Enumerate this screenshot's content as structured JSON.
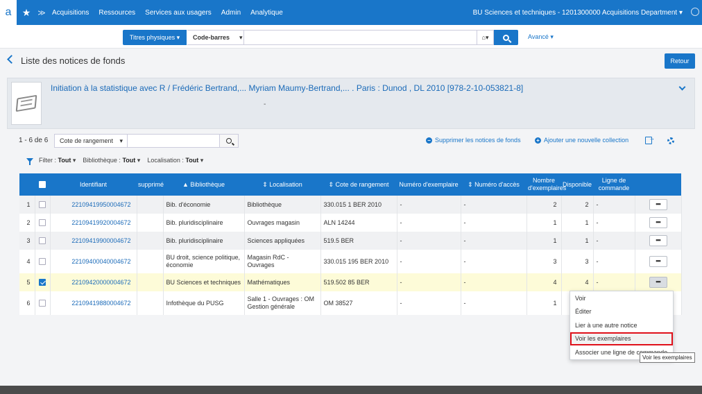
{
  "topnav": {
    "logo_fragment": "a",
    "items": [
      "Acquisitions",
      "Ressources",
      "Services aux usagers",
      "Admin",
      "Analytique"
    ],
    "institution": "BU Sciences et techniques - 1201300000 Acquisitions Department ▾"
  },
  "search": {
    "scope": "Titres physiques ▾",
    "field": "Code-barres",
    "value": "",
    "advanced": "Avancé ▾"
  },
  "page": {
    "title": "Liste des notices de fonds",
    "back_button": "Retour"
  },
  "record": {
    "title": "Initiation à la statistique avec R / Frédéric Bertrand,... Myriam Maumy-Bertrand,... . Paris : Dunod , DL 2010 [978-2-10-053821-8]",
    "subtitle": "-"
  },
  "toolbar": {
    "count": "1 - 6 de 6",
    "sort_field": "Cote de rangement",
    "filter_value": "",
    "delete_link": "Supprimer les notices de fonds",
    "add_link": "Ajouter une nouvelle collection"
  },
  "filters": {
    "filter_label": "Filter :",
    "filter_value": "Tout",
    "library_label": "Bibliothèque :",
    "library_value": "Tout",
    "location_label": "Localisation :",
    "location_value": "Tout"
  },
  "table": {
    "headers": {
      "identifiant": "Identifiant",
      "supprime": "supprimé",
      "bibliotheque": "▲ Bibliothèque",
      "localisation": "⇕ Localisation",
      "cote": "⇕ Cote de rangement",
      "numero_exemplaire": "Numéro d'exemplaire",
      "numero_acces": "⇕ Numéro d'accès",
      "nombre_exemplaires": "Nombre d'exemplaires",
      "disponible": "Disponible",
      "ligne_commande": "Ligne de commande"
    },
    "rows": [
      {
        "n": "1",
        "id": "22109419950004672",
        "supprime": "",
        "biblio": "Bib. d'économie",
        "loc": "Bibliothèque",
        "cote": "330.015 1 BER 2010",
        "num_ex": "-",
        "num_acces": "-",
        "nb": "2",
        "dispo": "2",
        "ligne": "-",
        "checked": false
      },
      {
        "n": "2",
        "id": "22109419920004672",
        "supprime": "",
        "biblio": "Bib. pluridisciplinaire",
        "loc": "Ouvrages magasin",
        "cote": "ALN 14244",
        "num_ex": "-",
        "num_acces": "-",
        "nb": "1",
        "dispo": "1",
        "ligne": "-",
        "checked": false
      },
      {
        "n": "3",
        "id": "22109419900004672",
        "supprime": "",
        "biblio": "Bib. pluridisciplinaire",
        "loc": "Sciences appliquées",
        "cote": "519.5 BER",
        "num_ex": "-",
        "num_acces": "-",
        "nb": "1",
        "dispo": "1",
        "ligne": "-",
        "checked": false
      },
      {
        "n": "4",
        "id": "22109400040004672",
        "supprime": "",
        "biblio": "BU droit, science politique, économie",
        "loc": "Magasin RdC - Ouvrages",
        "cote": "330.015 195 BER 2010",
        "num_ex": "-",
        "num_acces": "-",
        "nb": "3",
        "dispo": "3",
        "ligne": "-",
        "checked": false
      },
      {
        "n": "5",
        "id": "22109420000004672",
        "supprime": "",
        "biblio": "BU Sciences et techniques",
        "loc": "Mathématiques",
        "cote": "519.502 85 BER",
        "num_ex": "-",
        "num_acces": "-",
        "nb": "4",
        "dispo": "4",
        "ligne": "-",
        "checked": true
      },
      {
        "n": "6",
        "id": "22109419880004672",
        "supprime": "",
        "biblio": "Infothèque du PUSG",
        "loc": "Salle 1 - Ouvrages : OM Gestion générale",
        "cote": "OM 38527",
        "num_ex": "-",
        "num_acces": "-",
        "nb": "1",
        "dispo": "",
        "ligne": "",
        "checked": false
      }
    ],
    "more_label": "•••"
  },
  "context_menu": {
    "items": [
      "Voir",
      "Éditer",
      "Lier à une autre notice",
      "Voir les exemplaires",
      "Associer une ligne de commande"
    ],
    "tooltip": "Voir les exemplaires"
  },
  "colors": {
    "primary": "#1976c9",
    "selected_row": "#fdfbd8",
    "highlight_outline": "#e0101a"
  }
}
